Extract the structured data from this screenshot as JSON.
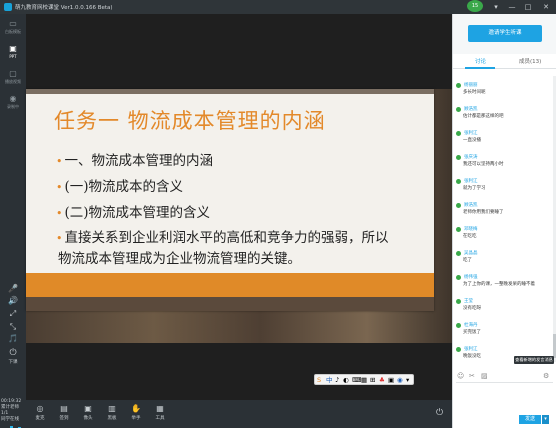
{
  "window": {
    "title": "萌九教育网校课堂 Ver1.0.0.166 Beta)",
    "avatar_text": "15",
    "controls": [
      "▾",
      "—",
      "□",
      "✕"
    ]
  },
  "sidebar": {
    "items": [
      {
        "icon": "whiteboard-icon",
        "glyph": "▭",
        "label": "白板模板"
      },
      {
        "icon": "ppt-icon",
        "glyph": "▣",
        "label": "PPT"
      },
      {
        "icon": "screen-share-icon",
        "glyph": "▢",
        "label": "播放视频"
      },
      {
        "icon": "record-icon",
        "glyph": "◉",
        "label": "录制中"
      }
    ],
    "tools": [
      "🎤",
      "🔊",
      "⤢",
      "⤡",
      "🎵"
    ],
    "power_label": "下课",
    "time": "00:19:32",
    "info_lines": [
      "累计老师",
      "1/1",
      "同学在线"
    ]
  },
  "slide": {
    "title": "任务一   物流成本管理的内涵",
    "lines": [
      {
        "bullet": "•",
        "text": "一、物流成本管理的内涵"
      },
      {
        "bullet": "•",
        "text": "(一)物流成本的含义"
      },
      {
        "bullet": "•",
        "text": "(二)物流成本管理的含义"
      },
      {
        "bullet": "•",
        "text": "直接关系到企业利润水平的高低和竞争力的强弱，所以"
      },
      {
        "bullet": "",
        "text": "物流成本管理成为企业物流管理的关键。"
      }
    ]
  },
  "emoji_bar": [
    "S",
    "中",
    "♪",
    "◐",
    "⌨",
    "▦",
    "⊞",
    "♣",
    "▣",
    "◉",
    "▾"
  ],
  "bottombar": {
    "buttons": [
      {
        "icon": "microphone-icon",
        "glyph": "◎",
        "label": "麦克"
      },
      {
        "icon": "sign-in-icon",
        "glyph": "▤",
        "label": "签到"
      },
      {
        "icon": "camera-icon",
        "glyph": "▣",
        "label": "像头"
      },
      {
        "icon": "board-icon",
        "glyph": "▥",
        "label": "黑板"
      },
      {
        "icon": "hand-icon",
        "glyph": "✋",
        "label": "举手"
      },
      {
        "icon": "tools-icon",
        "glyph": "▦",
        "label": "工具"
      }
    ]
  },
  "right_panel": {
    "comment_button": "邀请学生听课",
    "tab_discuss": "讨论",
    "tab_members": "成员(13)",
    "messages": [
      {
        "name": "杨丽丽",
        "text": "多长时间呢"
      },
      {
        "name": "顾浩凯",
        "text": "估计都是那这样的吧"
      },
      {
        "name": "张利江",
        "text": "一直没播"
      },
      {
        "name": "张庆涛",
        "text": "我还可以坚持两小时"
      },
      {
        "name": "张利江",
        "text": "就为了学习"
      },
      {
        "name": "顾浩凯",
        "text": "老师你用我们要睡了"
      },
      {
        "name": "邓晓梅",
        "text": "在吃吃"
      },
      {
        "name": "吴晶晶",
        "text": "吃了"
      },
      {
        "name": "杨伟强",
        "text": "为了上你的课，一整晚发呆的睡不着"
      },
      {
        "name": "王莹",
        "text": "没有吃呀"
      },
      {
        "name": "杜海丹",
        "text": "买完饭了"
      },
      {
        "name": "张利江",
        "text": "晚饭没吃"
      }
    ],
    "tooltip": "查看新增的发言消息",
    "input_tools": [
      "☺",
      "✂",
      "▨",
      "⚙"
    ],
    "send_label": "发送",
    "send_arrow": "▾"
  }
}
